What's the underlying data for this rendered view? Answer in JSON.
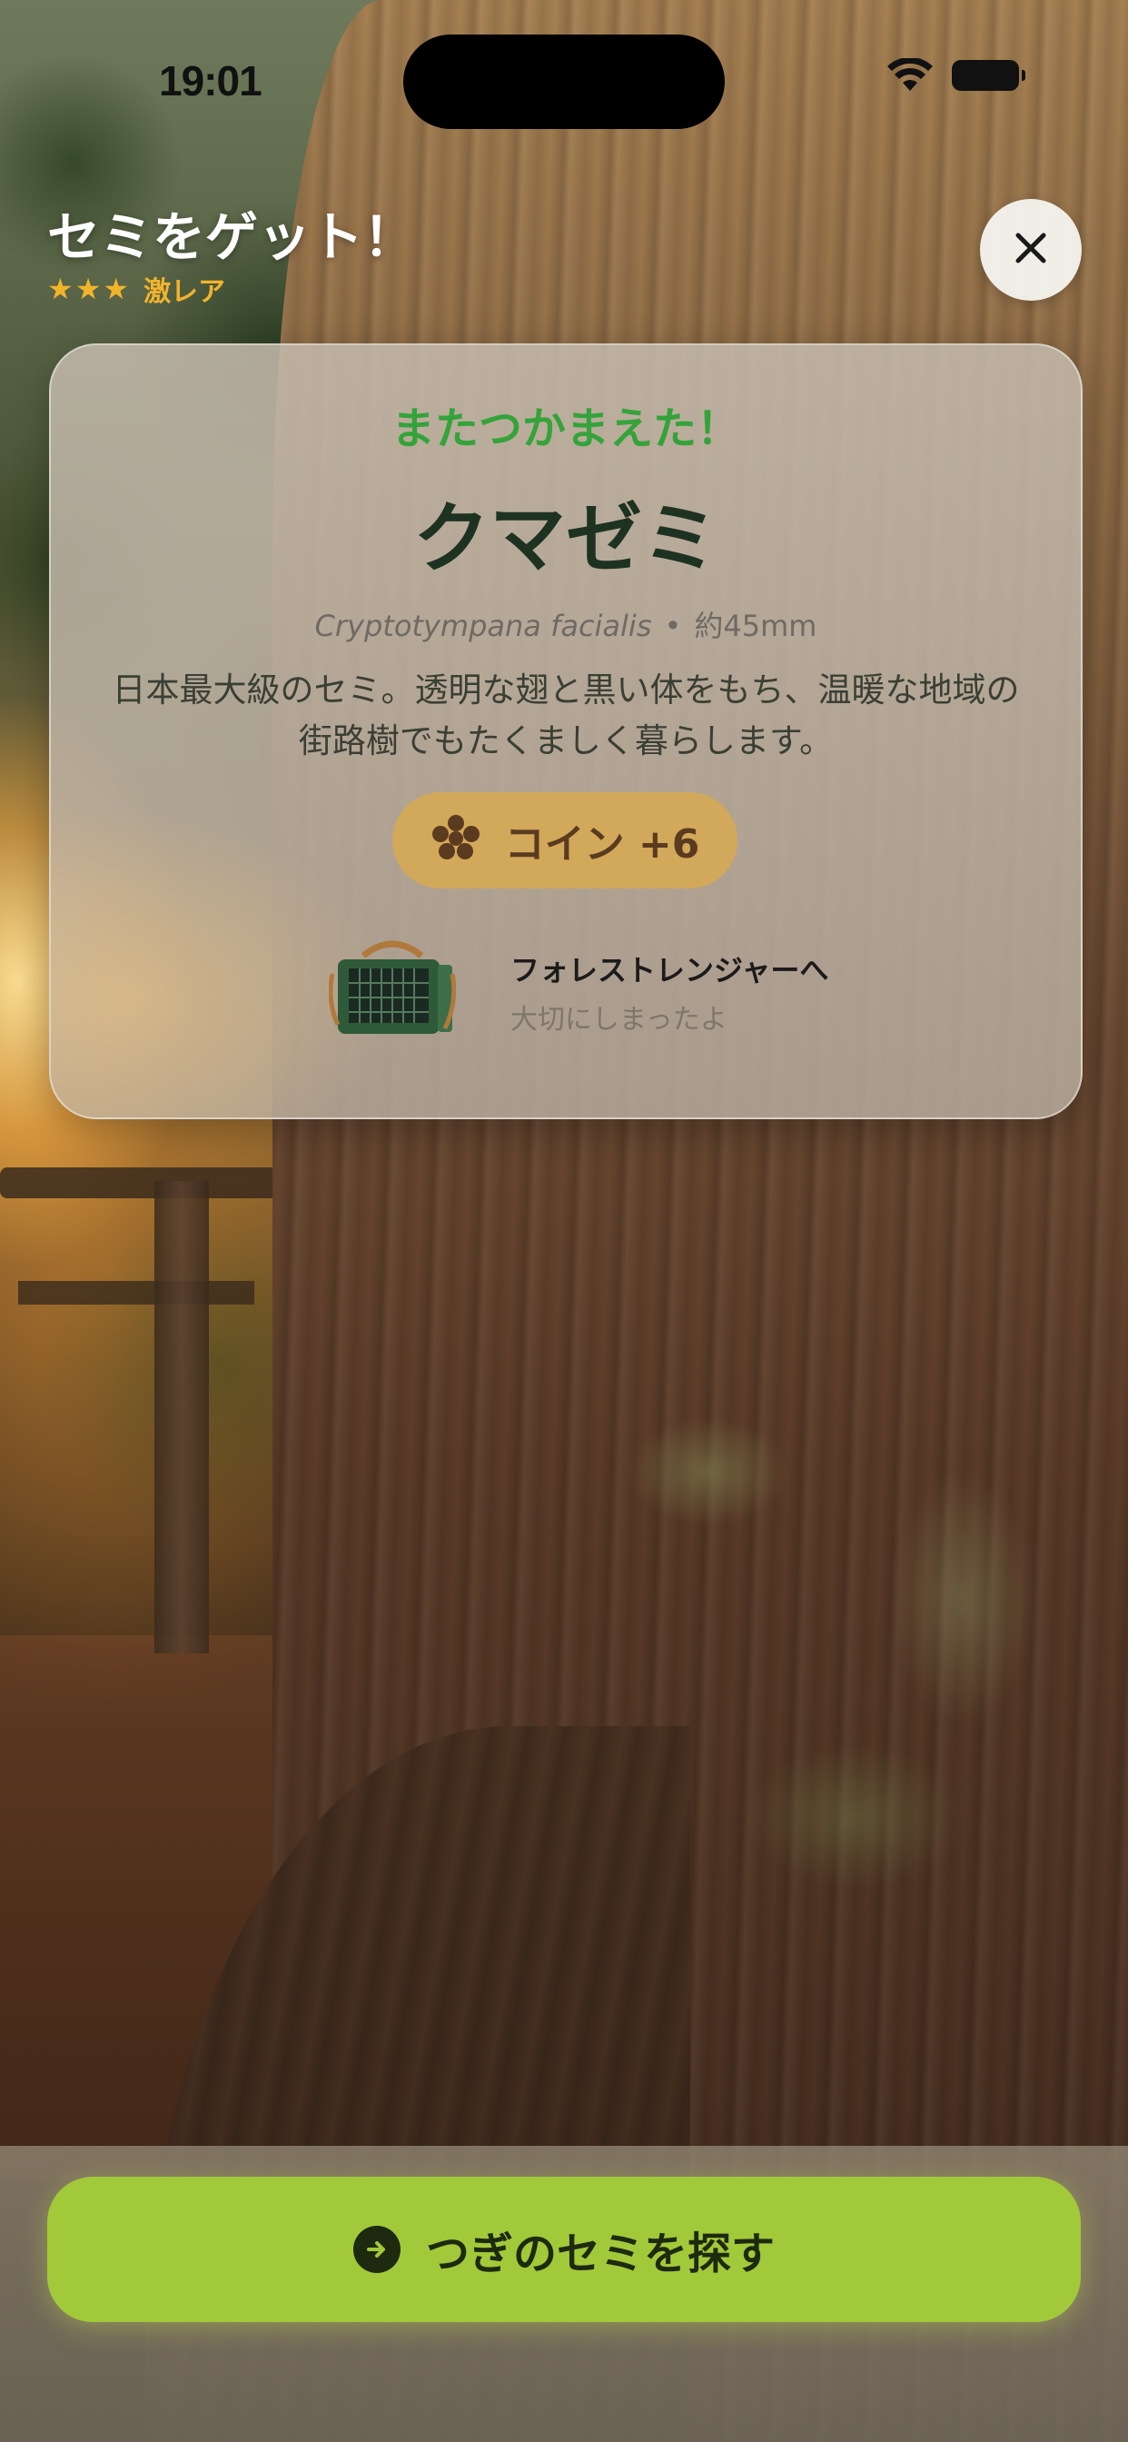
{
  "status_bar": {
    "time": "19:01"
  },
  "header": {
    "title": "セミをゲット！",
    "stars": 3,
    "rarity": "激レア"
  },
  "card": {
    "kicker": "またつかまえた！",
    "name": "クマゼミ",
    "scientific_name": "Cryptotympana facialis",
    "separator": "•",
    "size": "約45mm",
    "description": "日本最大級のセミ。透明な翅と黒い体をもち、温暖な地域の街路樹でもたくましく暮らします。",
    "coin_label": "コイン +6",
    "partner_title": "フォレストレンジャーへ",
    "partner_subtitle": "大切にしまったよ"
  },
  "action": {
    "next_label": "つぎのセミを探す"
  },
  "colors": {
    "accent_green": "#34a33a",
    "button_lime": "#a2c93a",
    "star_gold": "#f2b42b",
    "coin_pill": "#d2a85a"
  }
}
